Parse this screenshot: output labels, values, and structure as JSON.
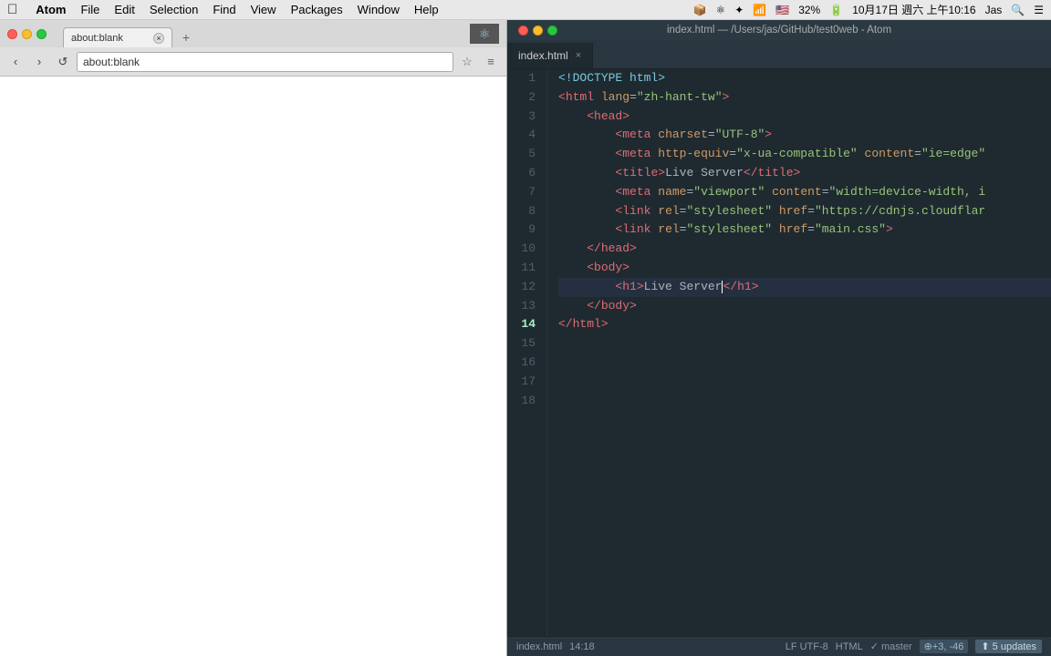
{
  "menubar": {
    "apple": "⌘",
    "items": [
      "Atom",
      "File",
      "Edit",
      "Selection",
      "Find",
      "View",
      "Packages",
      "Window",
      "Help"
    ],
    "right": {
      "dropbox": "📦",
      "battery_icon": "🔋",
      "battery_pct": "32%",
      "date": "10月17日 週六 上午10:16",
      "user": "Jas"
    }
  },
  "browser": {
    "tab_title": "about:blank",
    "address": "about:blank",
    "new_tab_label": "+"
  },
  "editor": {
    "titlebar": "index.html — /Users/jas/GitHub/test0web - Atom",
    "tab_filename": "index.html",
    "statusbar": {
      "filename": "index.html",
      "position": "14:18",
      "encoding": "LF  UTF-8",
      "syntax": "HTML",
      "branch": "✓ master",
      "diff": "+3, -46",
      "updates": "5 updates"
    }
  },
  "code_lines": [
    {
      "num": 1,
      "content": "<!DOCTYPE html>"
    },
    {
      "num": 2,
      "content": "<html lang=\"zh-hant-tw\">"
    },
    {
      "num": 3,
      "content": ""
    },
    {
      "num": 4,
      "content": "    <head>"
    },
    {
      "num": 5,
      "content": "        <meta charset=\"UTF-8\">"
    },
    {
      "num": 6,
      "content": "        <meta http-equiv=\"x-ua-compatible\" content=\"ie=edge\""
    },
    {
      "num": 7,
      "content": "        <title>Live Server</title>"
    },
    {
      "num": 8,
      "content": "        <meta name=\"viewport\" content=\"width=device-width, i"
    },
    {
      "num": 9,
      "content": "        <link rel=\"stylesheet\" href=\"https://cdnjs.cloudflar"
    },
    {
      "num": 10,
      "content": "        <link rel=\"stylesheet\" href=\"main.css\">"
    },
    {
      "num": 11,
      "content": "    </head>"
    },
    {
      "num": 12,
      "content": ""
    },
    {
      "num": 13,
      "content": "    <body>"
    },
    {
      "num": 14,
      "content": "        <h1>Live Server</h1>",
      "active": true
    },
    {
      "num": 15,
      "content": "    </body>"
    },
    {
      "num": 16,
      "content": ""
    },
    {
      "num": 17,
      "content": "</html>"
    },
    {
      "num": 18,
      "content": ""
    }
  ]
}
